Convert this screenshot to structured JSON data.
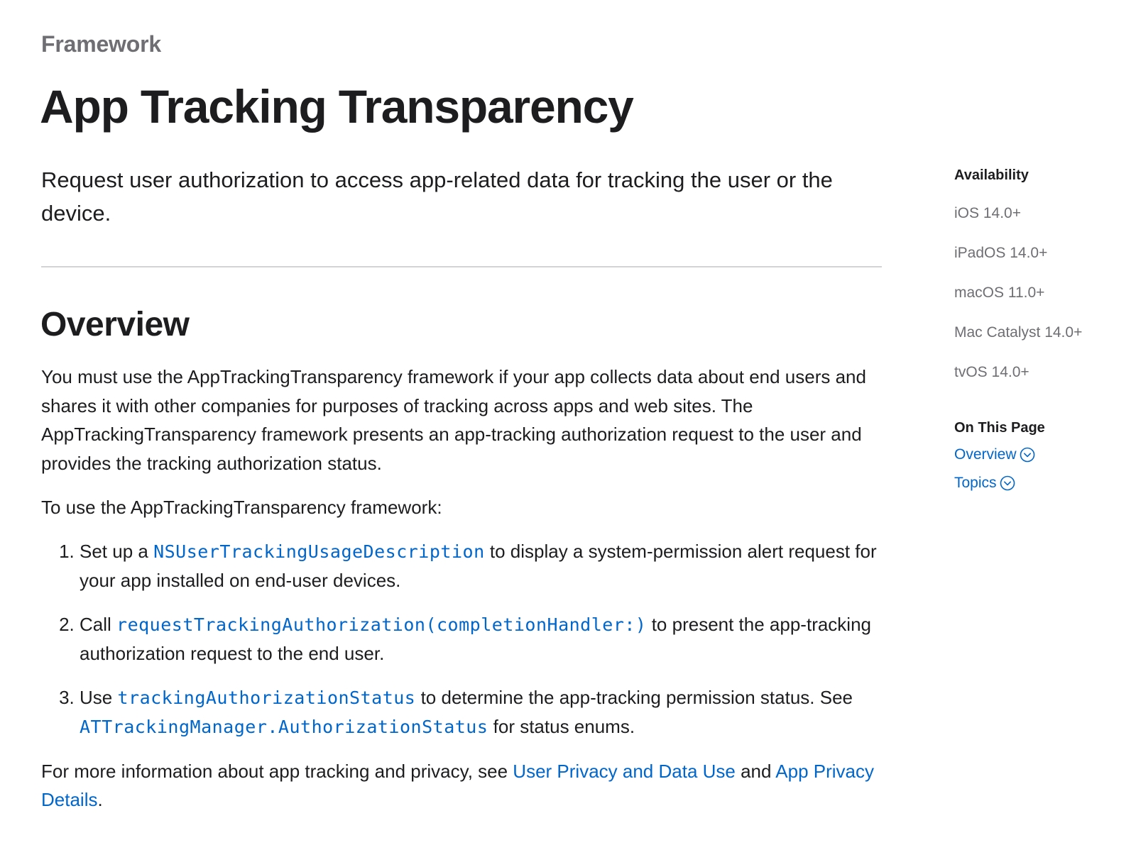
{
  "header": {
    "eyebrow": "Framework",
    "title": "App Tracking Transparency",
    "abstract": "Request user authorization to access app-related data for tracking the user or the device."
  },
  "overview": {
    "heading": "Overview",
    "paragraph1": "You must use the AppTrackingTransparency framework if your app collects data about end users and shares it with other companies for purposes of tracking across apps and web sites. The AppTrackingTransparency framework presents an app-tracking authorization request to the user and provides the tracking authorization status.",
    "paragraph2": "To use the AppTrackingTransparency framework:",
    "steps": [
      {
        "prefix": "Set up a ",
        "link": "NSUserTrackingUsageDescription",
        "suffix": " to display a system-permission alert request for your app installed on end-user devices."
      },
      {
        "prefix": "Call ",
        "link": "requestTrackingAuthorization(completionHandler:)",
        "suffix": " to present the app-tracking authorization request to the end user."
      },
      {
        "prefix": "Use ",
        "link": "trackingAuthorizationStatus",
        "middle": " to determine the app-tracking permission status. See ",
        "link2": "ATTrackingManager.AuthorizationStatus",
        "suffix": " for status enums."
      }
    ],
    "closing": {
      "prefix": "For more information about app tracking and privacy, see ",
      "link1": "User Privacy and Data Use",
      "middle": " and ",
      "link2": "App Privacy Details",
      "suffix": "."
    }
  },
  "sidebar": {
    "availability_heading": "Availability",
    "availability": [
      "iOS 14.0+",
      "iPadOS 14.0+",
      "macOS 11.0+",
      "Mac Catalyst 14.0+",
      "tvOS 14.0+"
    ],
    "on_this_page_heading": "On This Page",
    "on_this_page": [
      {
        "label": "Overview",
        "icon": "chevron-down-circle-icon"
      },
      {
        "label": "Topics",
        "icon": "chevron-down-circle-icon"
      }
    ]
  },
  "colors": {
    "link": "#0066cc",
    "text": "#1d1d1f",
    "secondary": "#6e6e73",
    "divider": "#d2d2d7"
  }
}
